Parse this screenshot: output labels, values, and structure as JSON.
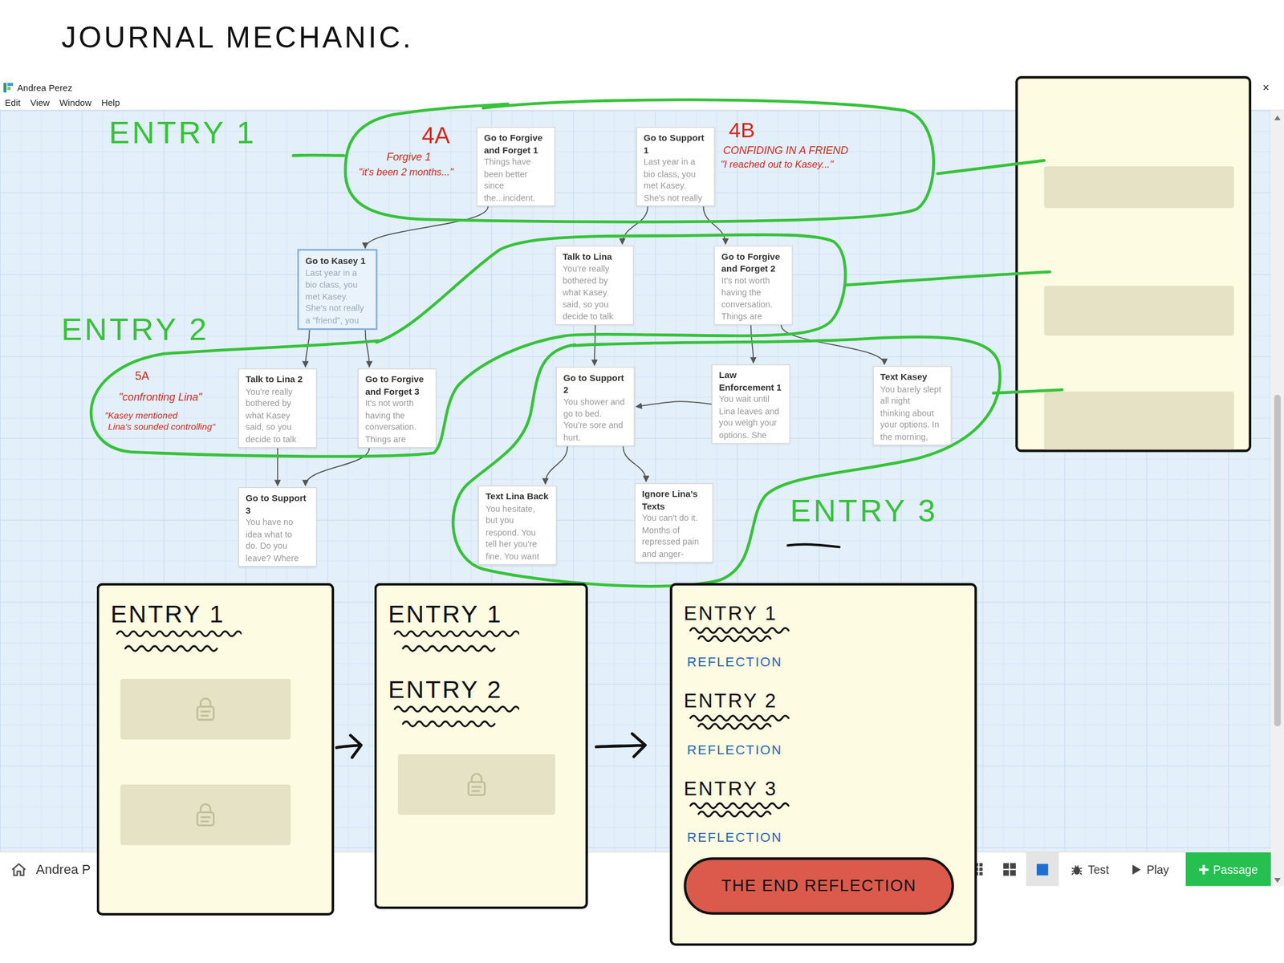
{
  "heading": "JOURNAL MECHANIC.",
  "window": {
    "title": "Andrea Perez",
    "close": "×"
  },
  "menu": [
    "Edit",
    "View",
    "Window",
    "Help"
  ],
  "passages": [
    {
      "title": "Go to Forgive and Forget 1",
      "excerpt": [
        "Things have",
        "been better",
        "since",
        "the...incident."
      ],
      "selected": false
    },
    {
      "title": "Go to Support 1",
      "excerpt": [
        "Last year in a",
        "bio class, you",
        "met Kasey.",
        "She's not really"
      ],
      "selected": false
    },
    {
      "title": "Go to Kasey 1",
      "excerpt": [
        "Last year in a",
        "bio class, you",
        "met Kasey.",
        "She's not really",
        "a \"friend\", you"
      ],
      "selected": true
    },
    {
      "title": "Talk to Lina",
      "excerpt": [
        "You're really",
        "bothered by",
        "what Kasey",
        "said, so you",
        "decide to talk"
      ],
      "selected": false
    },
    {
      "title": "Go to Forgive and Forget 2",
      "excerpt": [
        "It's not worth",
        "having the",
        "conversation.",
        "Things are"
      ],
      "selected": false
    },
    {
      "title": "Talk to Lina 2",
      "excerpt": [
        "You're really",
        "bothered by",
        "what Kasey",
        "said, so you",
        "decide to talk"
      ],
      "selected": false
    },
    {
      "title": "Go to Forgive and Forget 3",
      "excerpt": [
        "It's not worth",
        "having the",
        "conversation.",
        "Things are"
      ],
      "selected": false
    },
    {
      "title": "Go to Support 2",
      "excerpt": [
        "You shower and",
        "go to bed.",
        "You're sore and",
        "hurt."
      ],
      "selected": false
    },
    {
      "title": "Law Enforcement 1",
      "excerpt": [
        "You wait until",
        "Lina leaves and",
        "you weigh your",
        "options. She"
      ],
      "selected": false
    },
    {
      "title": "Text Kasey",
      "excerpt": [
        "You barely slept",
        "all night",
        "thinking about",
        "your options. In",
        "the morning,"
      ],
      "selected": false
    },
    {
      "title": "Go to Support 3",
      "excerpt": [
        "You have no",
        "idea what to",
        "do. Do you",
        "leave? Where"
      ],
      "selected": false
    },
    {
      "title": "Text Lina Back",
      "excerpt": [
        "You hesitate,",
        "but you",
        "respond. You",
        "tell her you're",
        "fine. You want"
      ],
      "selected": false
    },
    {
      "title": "Ignore Lina's Texts",
      "excerpt": [
        "You can't do it.",
        "Months of",
        "repressed pain",
        "and anger-"
      ],
      "selected": false
    }
  ],
  "links": [
    [
      0,
      2
    ],
    [
      1,
      3
    ],
    [
      1,
      4
    ],
    [
      2,
      5
    ],
    [
      2,
      6
    ],
    [
      3,
      7
    ],
    [
      4,
      8
    ],
    [
      4,
      9
    ],
    [
      8,
      7
    ],
    [
      7,
      11
    ],
    [
      7,
      12
    ],
    [
      5,
      10
    ],
    [
      6,
      10
    ]
  ],
  "annotations": {
    "entries": [
      {
        "label": "ENTRY 1"
      },
      {
        "label": "ENTRY 2"
      },
      {
        "label": "ENTRY 3"
      }
    ],
    "notes": [
      {
        "tag": "4A",
        "lines": [
          "Forgive 1",
          "\"it's been 2 months...\""
        ]
      },
      {
        "tag": "4B",
        "lines": [
          "CONFIDING IN A FRIEND",
          "\"I reached out to Kasey...\""
        ]
      },
      {
        "tag": "5A",
        "lines": [
          "\"confronting Lina\"",
          "\"Kasey mentioned",
          "Lina's sounded controlling\""
        ]
      }
    ]
  },
  "journal_panel": {
    "slots": [
      {
        "filled": false
      },
      {
        "filled": false
      },
      {
        "filled": false
      }
    ]
  },
  "journal_pages": [
    {
      "items": [
        {
          "kind": "entry",
          "label": "ENTRY 1"
        },
        {
          "kind": "locked"
        },
        {
          "kind": "locked"
        }
      ]
    },
    {
      "items": [
        {
          "kind": "entry",
          "label": "ENTRY 1"
        },
        {
          "kind": "entry",
          "label": "ENTRY 2"
        },
        {
          "kind": "locked"
        }
      ]
    },
    {
      "items": [
        {
          "kind": "entry",
          "label": "ENTRY 1"
        },
        {
          "kind": "reflection",
          "label": "REFLECTION"
        },
        {
          "kind": "entry",
          "label": "ENTRY 2"
        },
        {
          "kind": "reflection",
          "label": "REFLECTION"
        },
        {
          "kind": "entry",
          "label": "ENTRY 3"
        },
        {
          "kind": "reflection",
          "label": "REFLECTION"
        },
        {
          "kind": "ending",
          "label": "THE END REFLECTION"
        }
      ]
    }
  ],
  "bottom_bar": {
    "project": "Andrea P",
    "views": [
      {
        "kind": "small",
        "selected": false
      },
      {
        "kind": "medium",
        "selected": false
      },
      {
        "kind": "large",
        "selected": true
      }
    ],
    "buttons": [
      {
        "label": "Test",
        "kind": "test"
      },
      {
        "label": "Play",
        "kind": "play"
      },
      {
        "label": "Passage",
        "kind": "add"
      }
    ]
  }
}
